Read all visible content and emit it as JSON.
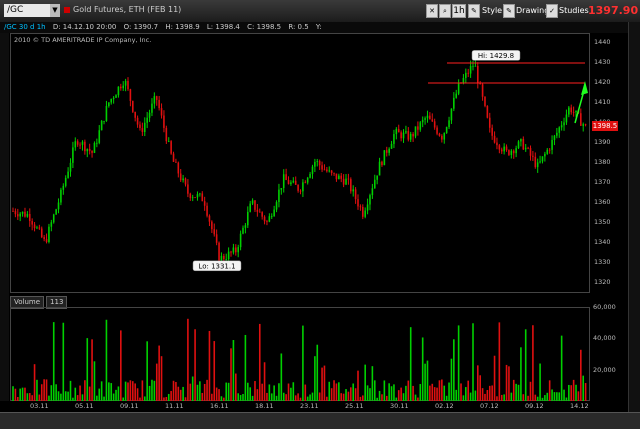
{
  "toolbar": {
    "symbol": "/GC",
    "description": "Gold Futures, ETH (FEB 11)",
    "interval": "1h",
    "style_label": "Style",
    "drawings_label": "Drawings",
    "studies_label": "Studies",
    "last_price": "1397.90",
    "last_price_color": "#ff3030"
  },
  "infobar": {
    "timeframe": "/GC 30 d 1h",
    "date": "D: 14.12.10 20:00",
    "open": "O: 1390.7",
    "high": "H: 1398.9",
    "low": "L: 1398.4",
    "close": "C: 1398.5",
    "range": "R: 0.5",
    "y": "Y:"
  },
  "chart": {
    "copyright": "2010 © TD AMERITRADE IP Company, Inc.",
    "hi_label": "Hi: 1429.8",
    "lo_label": "Lo: 1331.1",
    "current_price_tag": "1398.5"
  },
  "volume_panel": {
    "label": "Volume",
    "value": "113"
  },
  "chart_data": [
    {
      "type": "candlestick",
      "title": "Gold Futures, ETH (FEB 11)",
      "ylim": [
        1315,
        1445
      ],
      "y_ticks": [
        1320,
        1330,
        1340,
        1350,
        1360,
        1370,
        1380,
        1390,
        1400,
        1410,
        1420,
        1430,
        1440
      ],
      "x_ticks": [
        "03.11",
        "05.11",
        "09.11",
        "11.11",
        "16.11",
        "18.11",
        "23.11",
        "25.11",
        "30.11",
        "02.12",
        "07.12",
        "09.12",
        "14.12"
      ],
      "hi": 1429.8,
      "lo": 1331.1,
      "last": 1398.5,
      "close_path": [
        1356,
        1354,
        1340,
        1364,
        1392,
        1385,
        1410,
        1422,
        1395,
        1413,
        1382,
        1365,
        1362,
        1332,
        1336,
        1360,
        1350,
        1372,
        1367,
        1381,
        1374,
        1371,
        1355,
        1378,
        1395,
        1393,
        1403,
        1393,
        1418,
        1430,
        1395,
        1385,
        1390,
        1378,
        1392,
        1408,
        1398
      ],
      "horizontal_lines": [
        1430,
        1420
      ],
      "colors": {
        "up": "#00d000",
        "down": "#e01010",
        "lines": "#ff2020",
        "arrow": "#20ff20"
      }
    },
    {
      "type": "bar",
      "title": "Volume",
      "ylim": [
        0,
        60000
      ],
      "y_ticks": [
        "20,000",
        "40,000",
        "60,000"
      ]
    }
  ]
}
